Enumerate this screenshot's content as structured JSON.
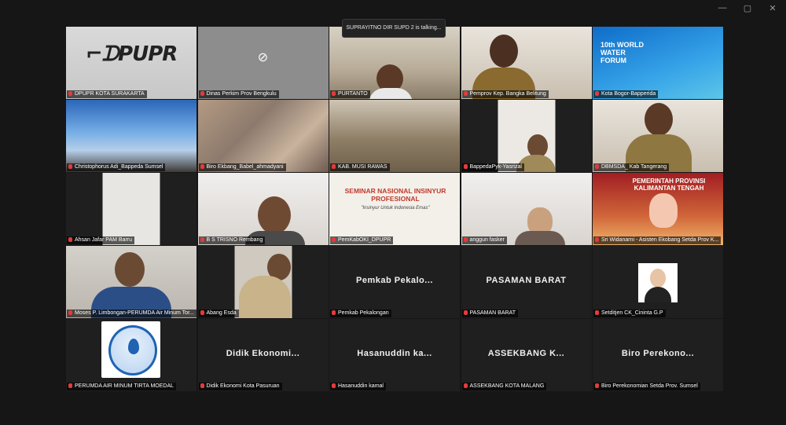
{
  "window": {
    "minimize": "—",
    "maximize": "▢",
    "close": "✕"
  },
  "speaker_banner": "SUPRAYITNO DIR SUPD 2 is talking...",
  "tiles": [
    {
      "name": "DPUPR KOTA SURAKARTA",
      "logo_text": "DPUPR"
    },
    {
      "name": "Dinas Perkim Prov Bengkulu",
      "camera": "camera-off-icon"
    },
    {
      "name": "PURTANTO"
    },
    {
      "name": "Pemprov Kep. Bangka Belitung"
    },
    {
      "name": "Kota Bogor-Bapperida",
      "slide_text": "10th WORLD WATER FORUM"
    },
    {
      "name": "Christophorus Adi_Bappeda Sumsel"
    },
    {
      "name": "Biro Ekbang_Babel_ahmadyani"
    },
    {
      "name": "KAB. MUSI RAWAS"
    },
    {
      "name": "BappedaPyk-Yasrizal"
    },
    {
      "name": "DBMSDA_ Kab Tangerang"
    },
    {
      "name": "Ahsan Jafar PAM Barru"
    },
    {
      "name": "B S TRISNO Rembang"
    },
    {
      "name": "PemKabOKI_DPUPR",
      "slide_title": "SEMINAR NASIONAL INSINYUR PROFESIONAL",
      "slide_sub": "\"Insinyur Untuk Indonesia Emas\""
    },
    {
      "name": "anggun fasker"
    },
    {
      "name": "Sri Widanarni - Asisten Ekobang Setda Prov K...",
      "slide_title": "PEMERINTAH PROVINSI KALIMANTAN TENGAH"
    },
    {
      "name": "Moses P. Limbongan-PERUMDA Air Minum Tor..."
    },
    {
      "name": "Abang Esda"
    },
    {
      "name": "Pemkab Pekalongan",
      "big": "Pemkab Pekalo..."
    },
    {
      "name": "PASAMAN BARAT",
      "big": "PASAMAN BARAT"
    },
    {
      "name": "Setditjen CK_Cininta G.P"
    },
    {
      "name": "PERUMDA AIR MINUM TIRTA MOEDAL",
      "logo_text": "Tirta Moedal"
    },
    {
      "name": "Didik Ekonomi Kota Pasuruan",
      "big": "Didik Ekonomi..."
    },
    {
      "name": "Hasanuddin kamal",
      "big": "Hasanuddin ka..."
    },
    {
      "name": "ASSEKBANG KOTA MALANG",
      "big": "ASSEKBANG K..."
    },
    {
      "name": "Biro Perekonomian Setda Prov. Sumsel",
      "big": "Biro Perekono..."
    }
  ]
}
